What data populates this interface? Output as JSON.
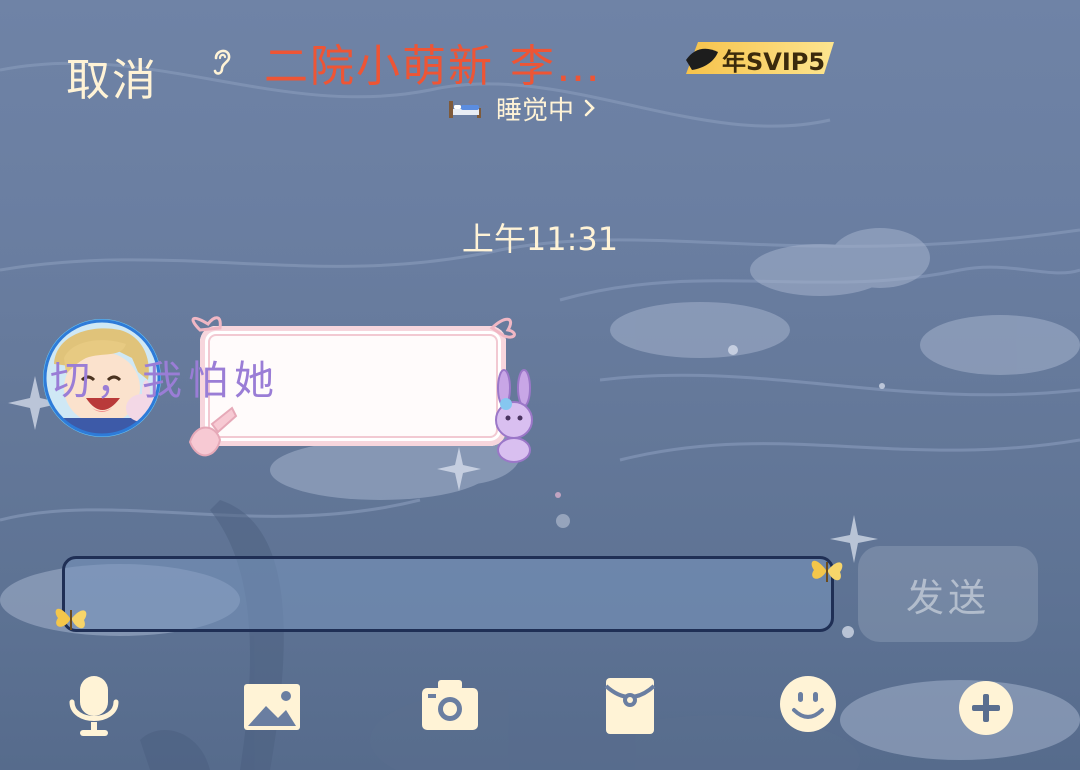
{
  "header": {
    "cancel_label": "取消",
    "contact_name": "二院小萌新 李…",
    "vip_badge": "年SVIP5",
    "status": "睡觉中",
    "ear_icon": "ear-icon",
    "status_icon": "bed-icon"
  },
  "chat": {
    "timestamp": "上午11:31",
    "messages": [
      {
        "sender": "contact",
        "text": "切，我怕她"
      }
    ]
  },
  "composer": {
    "input_value": "",
    "send_label": "发送"
  },
  "toolbar": {
    "items": [
      "microphone-icon",
      "image-icon",
      "camera-icon",
      "red-packet-icon",
      "emoji-icon",
      "plus-icon"
    ]
  },
  "colors": {
    "accent_name": "#ee5535",
    "header_text": "#fff3d6",
    "bubble_text": "#9a7dd6",
    "input_border": "#1f2f55"
  }
}
